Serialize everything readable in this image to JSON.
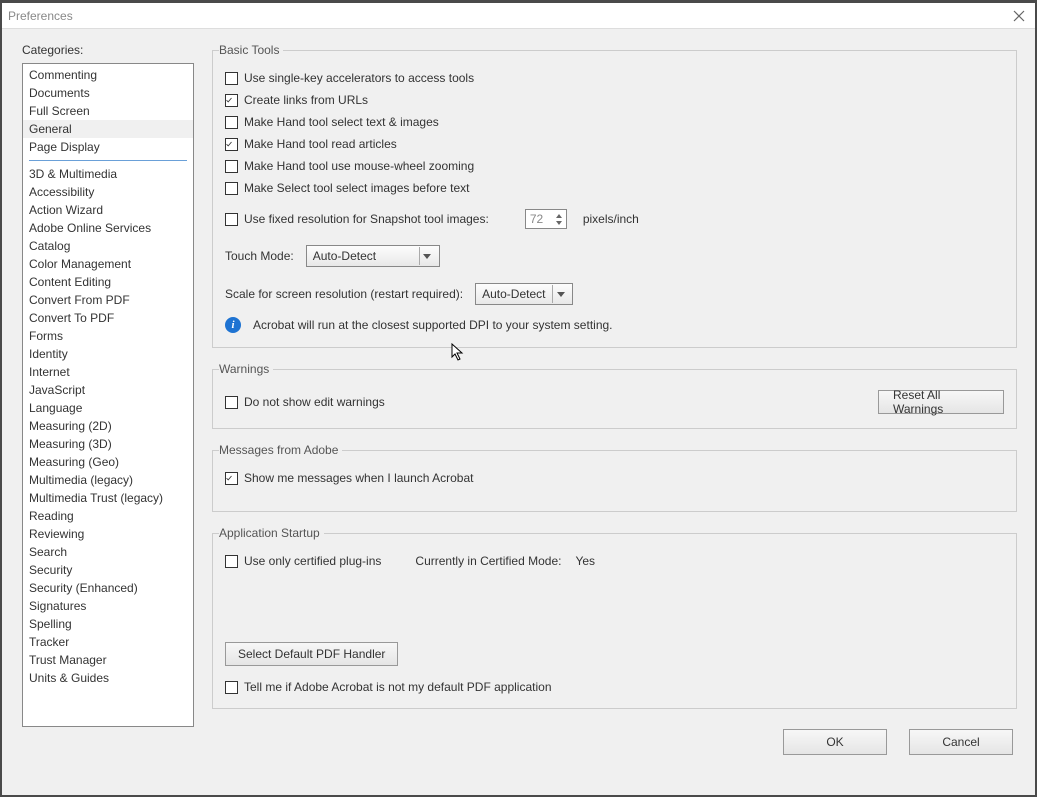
{
  "window": {
    "title": "Preferences"
  },
  "sidebar": {
    "label": "Categories:",
    "top": [
      "Commenting",
      "Documents",
      "Full Screen",
      "General",
      "Page Display"
    ],
    "selected": "General",
    "rest": [
      "3D & Multimedia",
      "Accessibility",
      "Action Wizard",
      "Adobe Online Services",
      "Catalog",
      "Color Management",
      "Content Editing",
      "Convert From PDF",
      "Convert To PDF",
      "Forms",
      "Identity",
      "Internet",
      "JavaScript",
      "Language",
      "Measuring (2D)",
      "Measuring (3D)",
      "Measuring (Geo)",
      "Multimedia (legacy)",
      "Multimedia Trust (legacy)",
      "Reading",
      "Reviewing",
      "Search",
      "Security",
      "Security (Enhanced)",
      "Signatures",
      "Spelling",
      "Tracker",
      "Trust Manager",
      "Units & Guides"
    ]
  },
  "basic": {
    "legend": "Basic Tools",
    "single_key": "Use single-key accelerators to access tools",
    "create_links": "Create links from URLs",
    "hand_select": "Make Hand tool select text & images",
    "hand_articles": "Make Hand tool read articles",
    "hand_wheel": "Make Hand tool use mouse-wheel zooming",
    "select_images": "Make Select tool select images before text",
    "fixed_res": "Use fixed resolution for Snapshot tool images:",
    "res_value": "72",
    "res_unit": "pixels/inch",
    "touch_label": "Touch Mode:",
    "touch_value": "Auto-Detect",
    "scale_label": "Scale for screen resolution (restart required):",
    "scale_value": "Auto-Detect",
    "info_text": "Acrobat will run at the closest supported DPI to your system setting."
  },
  "warnings": {
    "legend": "Warnings",
    "no_edit": "Do not show edit warnings",
    "reset": "Reset All Warnings"
  },
  "messages": {
    "legend": "Messages from Adobe",
    "show": "Show me messages when I launch Acrobat"
  },
  "startup": {
    "legend": "Application Startup",
    "certified": "Use only certified plug-ins",
    "cert_mode_label": "Currently in Certified Mode:",
    "cert_mode_val": "Yes",
    "select_handler": "Select Default PDF Handler",
    "tell_default": "Tell me if Adobe Acrobat is not my default PDF application"
  },
  "footer": {
    "ok": "OK",
    "cancel": "Cancel"
  }
}
